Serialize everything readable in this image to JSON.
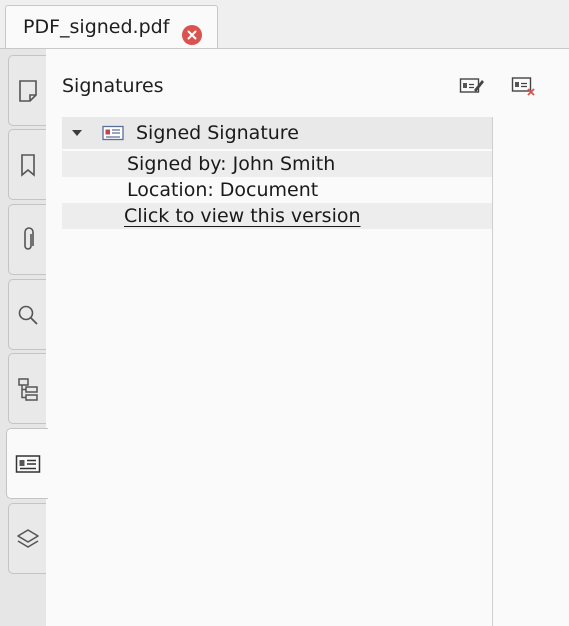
{
  "tab": {
    "title": "PDF_signed.pdf"
  },
  "panel": {
    "title": "Signatures",
    "signature": {
      "name": "Signed Signature",
      "signed_by": "Signed by: John Smith",
      "location": "Location: Document",
      "view_link": "Click to view this version"
    }
  },
  "sidebar_tabs": [
    "page-icon",
    "bookmark-icon",
    "paperclip-icon",
    "search-icon",
    "hierarchy-icon",
    "signature-card-icon",
    "layers-icon"
  ],
  "colors": {
    "close_button": "#d9534f"
  }
}
